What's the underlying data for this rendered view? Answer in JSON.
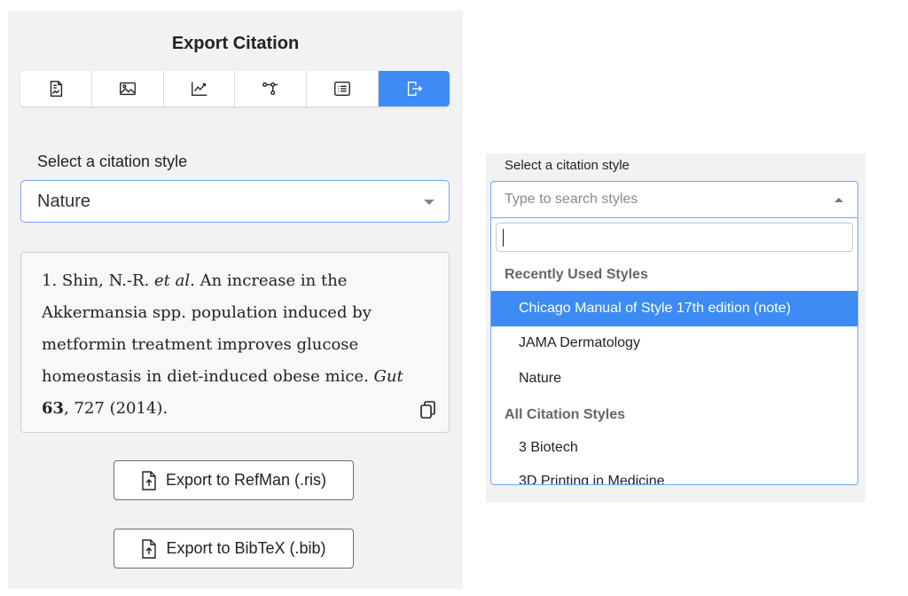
{
  "left": {
    "title": "Export Citation",
    "tabs": [
      {
        "icon": "document-icon"
      },
      {
        "icon": "image-icon"
      },
      {
        "icon": "chart-icon"
      },
      {
        "icon": "network-icon"
      },
      {
        "icon": "list-icon"
      },
      {
        "icon": "export-icon",
        "active": true
      }
    ],
    "style_label": "Select a citation style",
    "selected_style": "Nature",
    "citation": {
      "prefix": "1. Shin, N.-R. ",
      "etal": "et al",
      "body": ". An increase in the Akkermansia spp. population induced by metformin treatment improves glucose homeostasis in diet-induced obese mice. ",
      "journal": "Gut",
      "space": " ",
      "volume": "63",
      "rest": ", 727 (2014)."
    },
    "buttons": {
      "refman": "Export to RefMan (.ris)",
      "bibtex": "Export to BibTeX (.bib)"
    }
  },
  "right": {
    "label": "Select a citation style",
    "search_placeholder": "Type to search styles",
    "dropdown_search_value": "",
    "groups": {
      "recent": "Recently Used Styles",
      "all": "All Citation Styles"
    },
    "recent_items": [
      "Chicago Manual of Style 17th edition (note)",
      "JAMA Dermatology",
      "Nature"
    ],
    "all_items": [
      "3 Biotech",
      "3D Printing in Medicine"
    ]
  },
  "colors": {
    "accent": "#3d8bf5",
    "focus_border": "#6ea8f4",
    "panel_bg": "#f2f2f2"
  }
}
